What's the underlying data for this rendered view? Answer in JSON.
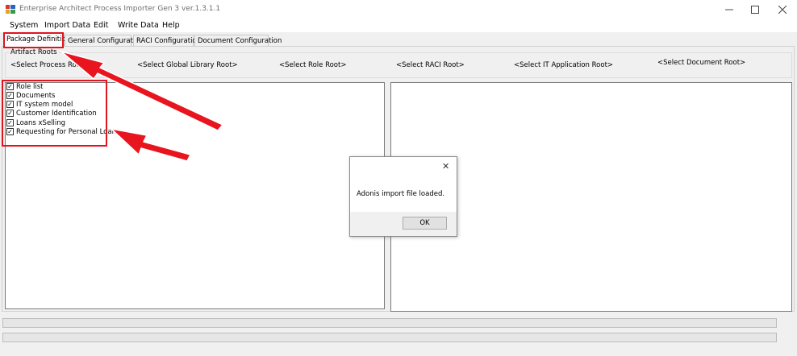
{
  "window": {
    "title": "Enterprise Architect Process Importer Gen 3 ver.1.3.1.1",
    "icons": [
      "app-icon",
      "minimize-icon",
      "maximize-icon",
      "close-icon"
    ]
  },
  "menu": [
    "System",
    "Import Data",
    "Edit",
    "Write Data",
    "Help"
  ],
  "tabs": [
    "Package Definition",
    "General Configuration",
    "RACI Configuration",
    "Document Configuration"
  ],
  "artifact_roots": {
    "legend": "Artifact Roots",
    "links": [
      "<Select Process Root>",
      "<Select Global Library Root>",
      "<Select Role Root>",
      "<Select RACI Root>",
      "<Select IT Application Root>",
      "<Select Document Root>"
    ]
  },
  "packages": [
    {
      "label": "Role list",
      "checked": true
    },
    {
      "label": "Documents",
      "checked": true
    },
    {
      "label": "IT system model",
      "checked": true
    },
    {
      "label": "Customer Identification",
      "checked": true
    },
    {
      "label": "Loans xSelling",
      "checked": true
    },
    {
      "label": "Requesting for Personal Loan",
      "checked": true
    }
  ],
  "dialog": {
    "message": "Adonis import file loaded.",
    "ok_label": "OK",
    "close_glyph": "✕"
  },
  "colors": {
    "annotation_red": "#e0141e",
    "window_bg": "#f0f0f0"
  }
}
